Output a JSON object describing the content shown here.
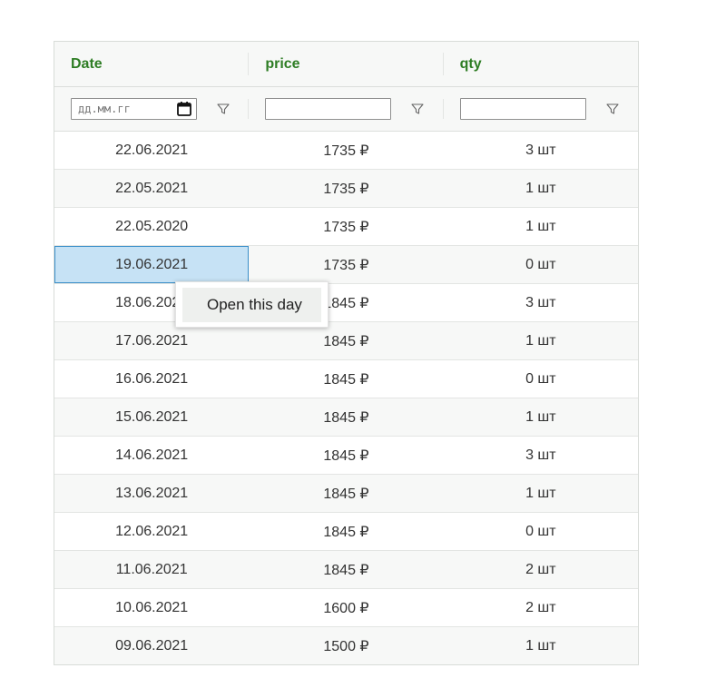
{
  "grid": {
    "columns": [
      {
        "label": "Date"
      },
      {
        "label": "price"
      },
      {
        "label": "qty"
      }
    ],
    "filters": {
      "date_placeholder": "дд.мм.гг",
      "price_value": "",
      "qty_value": ""
    },
    "rows": [
      {
        "date": "22.06.2021",
        "price": "1735 ₽",
        "qty": "3 шт"
      },
      {
        "date": "22.05.2021",
        "price": "1735 ₽",
        "qty": "1 шт"
      },
      {
        "date": "22.05.2020",
        "price": "1735 ₽",
        "qty": "1 шт"
      },
      {
        "date": "19.06.2021",
        "price": "1735 ₽",
        "qty": "0 шт"
      },
      {
        "date": "18.06.2021",
        "price": "1845 ₽",
        "qty": "3 шт"
      },
      {
        "date": "17.06.2021",
        "price": "1845 ₽",
        "qty": "1 шт"
      },
      {
        "date": "16.06.2021",
        "price": "1845 ₽",
        "qty": "0 шт"
      },
      {
        "date": "15.06.2021",
        "price": "1845 ₽",
        "qty": "1 шт"
      },
      {
        "date": "14.06.2021",
        "price": "1845 ₽",
        "qty": "3 шт"
      },
      {
        "date": "13.06.2021",
        "price": "1845 ₽",
        "qty": "1 шт"
      },
      {
        "date": "12.06.2021",
        "price": "1845 ₽",
        "qty": "0 шт"
      },
      {
        "date": "11.06.2021",
        "price": "1845 ₽",
        "qty": "2 шт"
      },
      {
        "date": "10.06.2021",
        "price": "1600 ₽",
        "qty": "2 шт"
      },
      {
        "date": "09.06.2021",
        "price": "1500 ₽",
        "qty": "1 шт"
      }
    ],
    "selected_row": 3
  },
  "context_menu": {
    "items": [
      {
        "label": "Open this day"
      }
    ]
  },
  "icons": {
    "filter": "filter-funnel-icon",
    "calendar": "calendar-icon"
  },
  "colors": {
    "header_text": "#2e7d24",
    "selection_fill": "#c6e2f5",
    "selection_border": "#3b8fc9"
  }
}
